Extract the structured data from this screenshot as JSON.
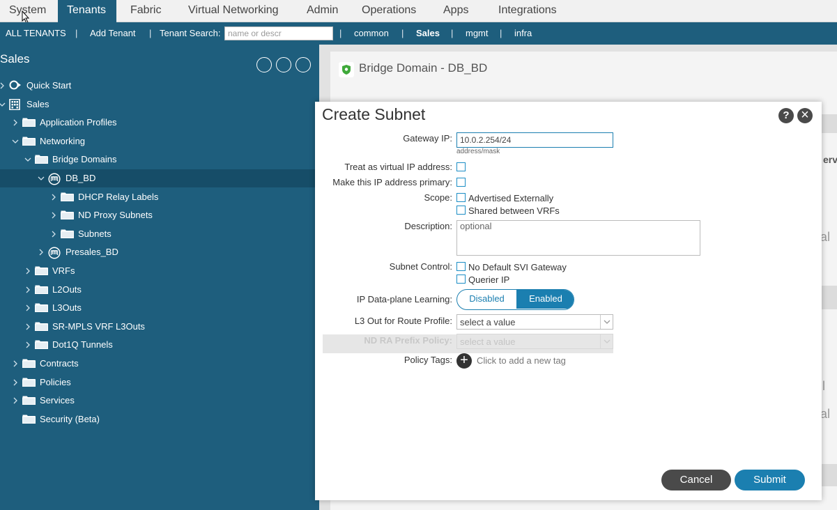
{
  "topnav": {
    "tabs": [
      "System",
      "Tenants",
      "Fabric",
      "Virtual Networking",
      "Admin",
      "Operations",
      "Apps",
      "Integrations"
    ]
  },
  "subnav": {
    "all_tenants": "ALL TENANTS",
    "add_tenant": "Add Tenant",
    "search_label": "Tenant Search:",
    "search_placeholder": "name or descr",
    "tenants": [
      "common",
      "Sales",
      "mgmt",
      "infra"
    ]
  },
  "tree": {
    "title": "Sales",
    "items": [
      {
        "label": "Quick Start"
      },
      {
        "label": "Sales"
      },
      {
        "label": "Application Profiles"
      },
      {
        "label": "Networking"
      },
      {
        "label": "Bridge Domains"
      },
      {
        "label": "DB_BD"
      },
      {
        "label": "DHCP Relay Labels"
      },
      {
        "label": "ND Proxy Subnets"
      },
      {
        "label": "Subnets"
      },
      {
        "label": "Presales_BD"
      },
      {
        "label": "VRFs"
      },
      {
        "label": "L2Outs"
      },
      {
        "label": "L3Outs"
      },
      {
        "label": "SR-MPLS VRF L3Outs"
      },
      {
        "label": "Dot1Q Tunnels"
      },
      {
        "label": "Contracts"
      },
      {
        "label": "Policies"
      },
      {
        "label": "Services"
      },
      {
        "label": "Security (Beta)"
      }
    ]
  },
  "background": {
    "bd_title": "Bridge Domain - DB_BD",
    "peek": [
      "erv",
      "al",
      "l",
      "al"
    ]
  },
  "modal": {
    "title": "Create Subnet",
    "help": "?",
    "close": "×",
    "gateway_label": "Gateway IP:",
    "gateway_value": "10.0.2.254/24",
    "gateway_hint": "address/mask",
    "virtual_ip_label": "Treat as virtual IP address:",
    "primary_label": "Make this IP address primary:",
    "scope_label": "Scope:",
    "scope_options": [
      "Advertised Externally",
      "Shared between VRFs"
    ],
    "description_label": "Description:",
    "description_placeholder": "optional",
    "subnet_control_label": "Subnet Control:",
    "subnet_control_options": [
      "No Default SVI Gateway",
      "Querier IP"
    ],
    "learning_label": "IP Data-plane Learning:",
    "learning_options": [
      "Disabled",
      "Enabled"
    ],
    "learning_selected": "Enabled",
    "l3out_label": "L3 Out for Route Profile:",
    "l3out_value": "select a value",
    "nd_ra_label": "ND RA Prefix Policy:",
    "nd_ra_value": "select a value",
    "policy_tags_label": "Policy Tags:",
    "policy_tags_add": "Click to add a new tag",
    "cancel_label": "Cancel",
    "submit_label": "Submit"
  },
  "colors": {
    "nav_blue": "#1e5e7d",
    "accent": "#1b7fb0",
    "cancel": "#4a4a4a"
  }
}
